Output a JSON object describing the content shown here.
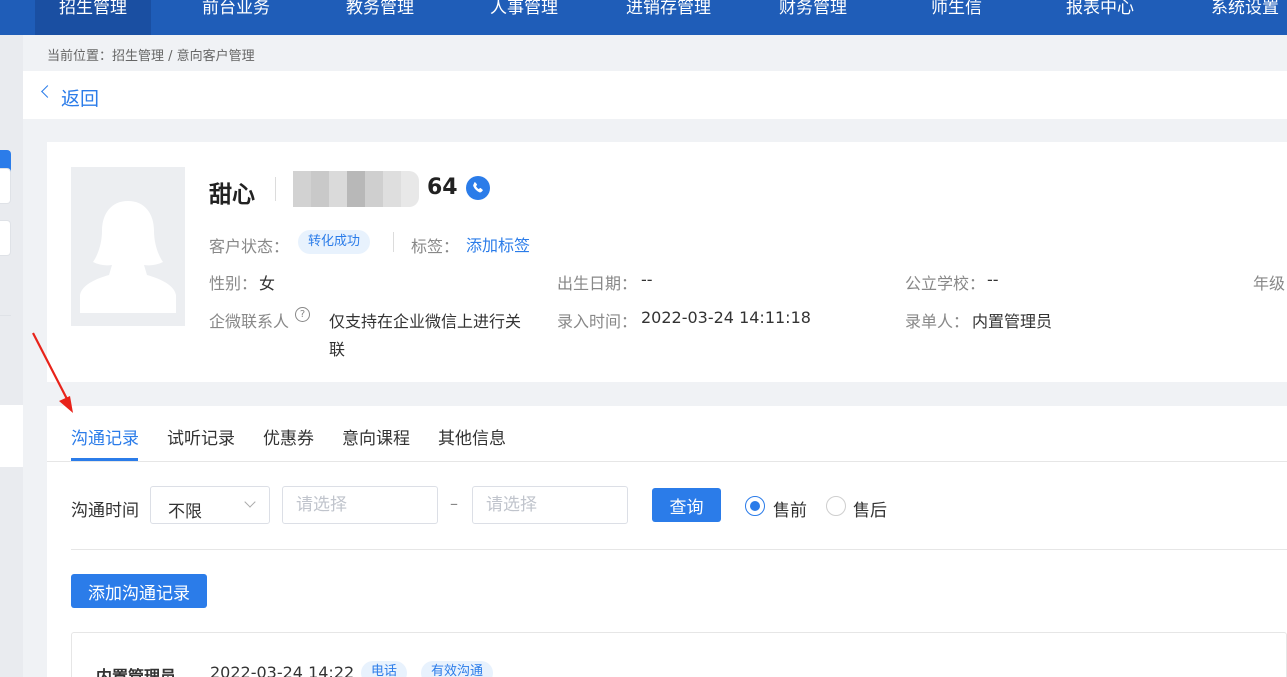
{
  "topnav": {
    "tabs": [
      "招生管理",
      "前台业务",
      "教务管理",
      "人事管理",
      "进销存管理",
      "财务管理",
      "师生信",
      "报表中心",
      "系统设置"
    ],
    "active_index": 0,
    "bg_color": "#1f5db8"
  },
  "breadcrumb": "当前位置：招生管理 / 意向客户管理",
  "back_label": "返回",
  "customer": {
    "name": "甜心",
    "phone_suffix": "64",
    "status_label": "客户状态：",
    "status_value": "转化成功",
    "tag_label": "标签：",
    "add_tag": "添加标签",
    "gender_label": "性别：",
    "gender_value": "女",
    "birthday_label": "出生日期：",
    "birthday_value": "--",
    "school_label": "公立学校：",
    "school_value": "--",
    "grade_label": "年级",
    "wecom_label": "企微联系人",
    "wecom_help": "?",
    "wecom_value_line1": "仅支持在企业微信上进行关",
    "wecom_value_line2": "联",
    "entry_time_label": "录入时间：",
    "entry_time_value": "2022-03-24 14:11:18",
    "creator_label": "录单人：",
    "creator_value": "内置管理员"
  },
  "tabs": [
    "沟通记录",
    "试听记录",
    "优惠券",
    "意向课程",
    "其他信息"
  ],
  "active_tab": 0,
  "filter": {
    "label": "沟通时间",
    "select_value": "不限",
    "date_start_placeholder": "请选择",
    "date_end_placeholder": "请选择",
    "dash": "–",
    "query_button": "查询",
    "radio_pre": "售前",
    "radio_post": "售后",
    "radio_selected": "售前"
  },
  "add_record_button": "添加沟通记录",
  "record": {
    "author": "内置管理员",
    "time": "2022-03-24 14:22",
    "tags": [
      "电话",
      "有效沟通"
    ]
  },
  "accent_color": "#2b7ce9",
  "annotation_arrow_color": "#e8231a"
}
